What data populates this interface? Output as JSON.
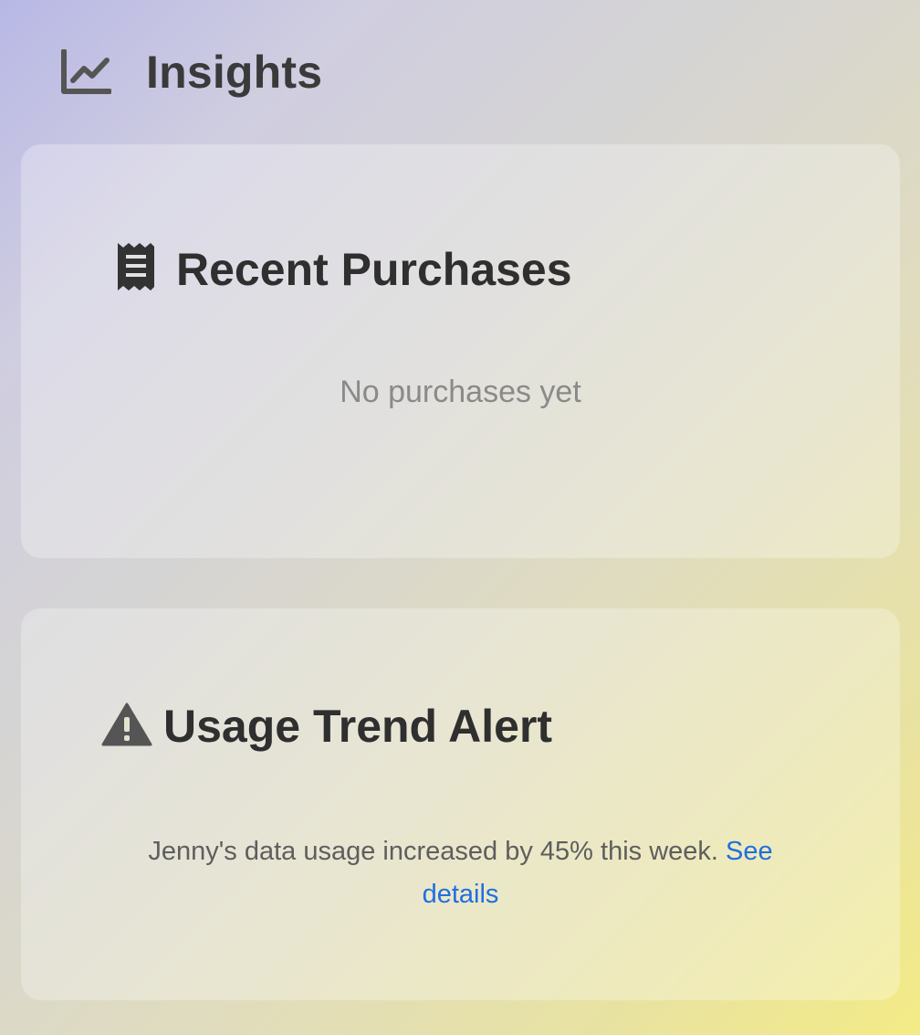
{
  "header": {
    "icon": "line-chart-icon",
    "title": "Insights"
  },
  "cards": {
    "purchases": {
      "icon": "receipt-icon",
      "title": "Recent Purchases",
      "empty_text": "No purchases yet"
    },
    "alert": {
      "icon": "warning-icon",
      "title": "Usage Trend Alert",
      "message": "Jenny's data usage increased by 45% this week.",
      "link_label": "See details"
    }
  },
  "colors": {
    "text_primary": "#2f2f2f",
    "text_muted": "#8a8a8a",
    "link": "#1f6fe0"
  }
}
